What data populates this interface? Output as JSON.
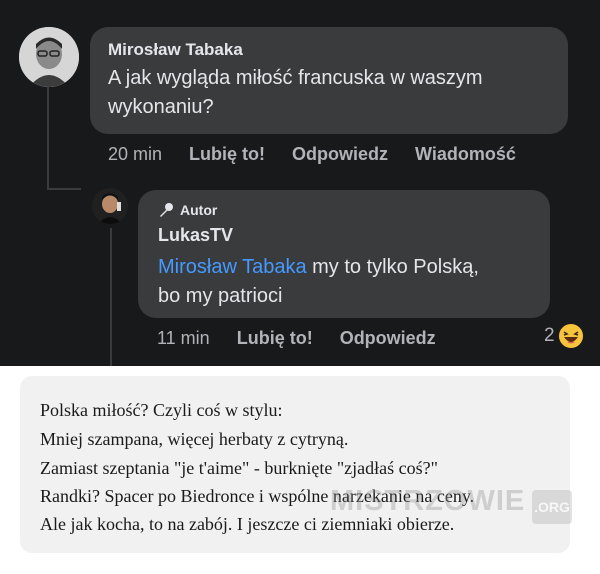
{
  "colors": {
    "background": "#18191a",
    "bubble": "#3a3b3c",
    "text": "#e4e6eb",
    "secondary": "#b0b3b8",
    "mention": "#4599ff",
    "card": "#f1f1f1"
  },
  "comment": {
    "author": "Mirosław Tabaka",
    "text": "A jak wygląda miłość francuska w waszym wykonaniu?",
    "time": "20 min",
    "like_label": "Lubię to!",
    "reply_label": "Odpowiedz",
    "message_label": "Wiadomość"
  },
  "reply": {
    "badge_icon": "microphone-icon",
    "badge_label": "Autor",
    "author": "LukasTV",
    "mention": "Mirosław Tabaka",
    "text_line1": " my to tylko Polską,",
    "text_line2": "bo my patrioci",
    "time": "11 min",
    "like_label": "Lubię to!",
    "reply_label": "Odpowiedz",
    "reaction_count": "2",
    "reaction_icon": "laughing-emoji-icon"
  },
  "card": {
    "lines": [
      "Polska miłość? Czyli coś w stylu:",
      "Mniej szampana, więcej herbaty z cytryną.",
      "Zamiast szeptania \"je t'aime\" - burknięte \"zjadłaś coś?\"",
      "Randki? Spacer po Biedronce i wspólne narzekanie na ceny.",
      "Ale jak kocha, to na zabój. I jeszcze ci ziemniaki obierze."
    ]
  },
  "watermark": {
    "text": "MISTRZOWIE",
    "suffix": ".ORG"
  }
}
